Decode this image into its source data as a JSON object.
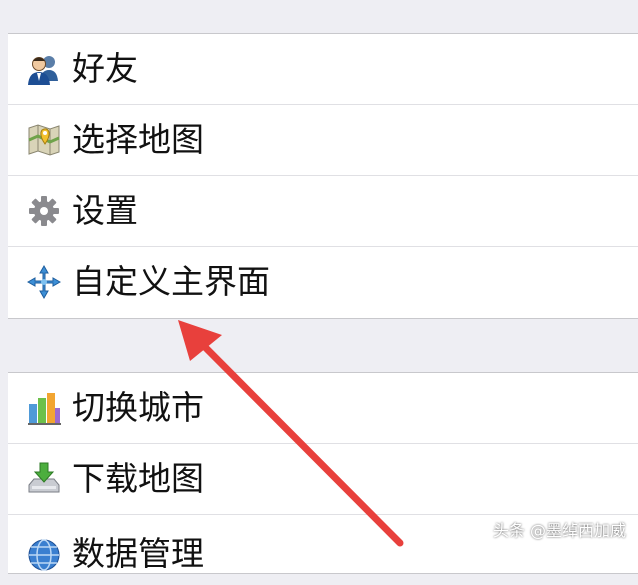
{
  "group1": {
    "items": [
      {
        "label": "好友",
        "icon": "friends-icon"
      },
      {
        "label": "选择地图",
        "icon": "map-select-icon"
      },
      {
        "label": "设置",
        "icon": "gear-icon"
      },
      {
        "label": "自定义主界面",
        "icon": "customize-icon"
      }
    ]
  },
  "group2": {
    "items": [
      {
        "label": "切换城市",
        "icon": "city-bars-icon"
      },
      {
        "label": "下载地图",
        "icon": "download-icon"
      },
      {
        "label": "数据管理",
        "icon": "globe-icon"
      }
    ]
  },
  "watermark": "头条 @墨绰西加威",
  "colors": {
    "background": "#eeeef3",
    "arrow": "#e8403c"
  }
}
